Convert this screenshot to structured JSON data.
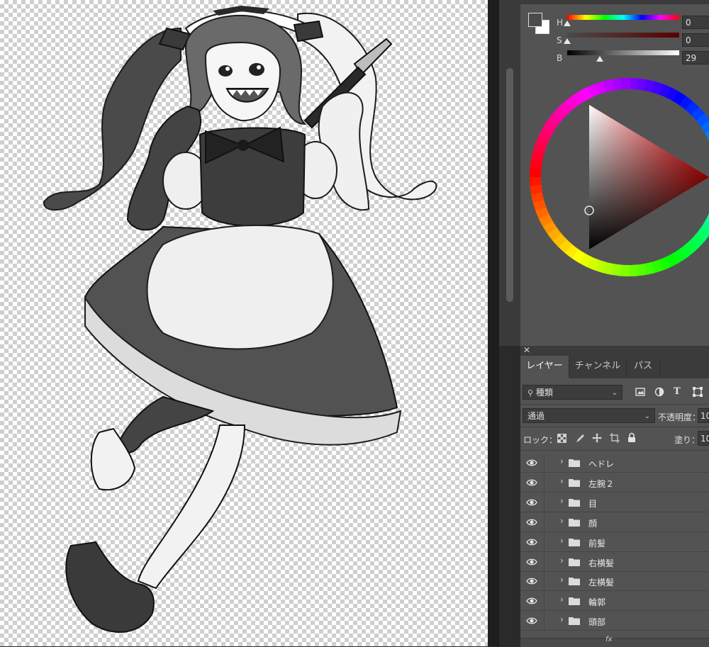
{
  "color_panel": {
    "h_label": "H",
    "s_label": "S",
    "b_label": "B",
    "h_value": "0",
    "s_value": "0",
    "b_value": "29",
    "h_level": 0,
    "s_level": 0,
    "b_level": 0.29,
    "foreground_color": "#4a4a4a",
    "background_color": "#ffffff"
  },
  "layers_panel": {
    "close_icon": "close-icon",
    "tabs": [
      {
        "label": "レイヤー",
        "active": true
      },
      {
        "label": "チャンネル",
        "active": false
      },
      {
        "label": "パス",
        "active": false
      }
    ],
    "filter_kind": "種類",
    "blend_mode": "通過",
    "opacity_label": "不透明度：",
    "opacity_value": "10",
    "lock_label": "ロック：",
    "fill_label": "塗り：",
    "fill_value": "10",
    "layers": [
      {
        "name": "ヘドレ",
        "visible": true
      },
      {
        "name": "左腕２",
        "visible": true
      },
      {
        "name": "目",
        "visible": true
      },
      {
        "name": "顔",
        "visible": true
      },
      {
        "name": "前髪",
        "visible": true
      },
      {
        "name": "右横髪",
        "visible": true
      },
      {
        "name": "左横髪",
        "visible": true
      },
      {
        "name": "輪郭",
        "visible": true
      },
      {
        "name": "頭部",
        "visible": true
      }
    ],
    "footer_fx": "fx"
  },
  "canvas": {
    "checker_color": "#cfcfcf",
    "artwork": "grayscale maid character illustration"
  }
}
